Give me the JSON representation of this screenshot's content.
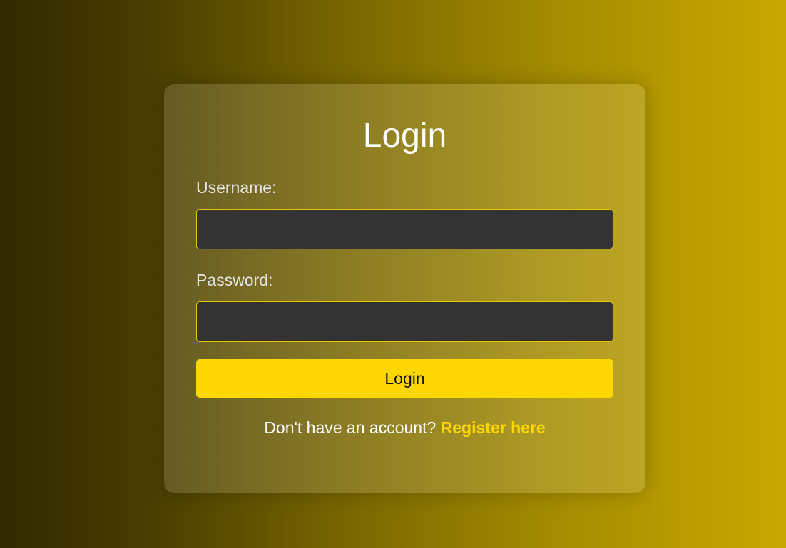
{
  "colors": {
    "accent": "#ffd700",
    "input_background": "#333333",
    "input_border": "#e7c500",
    "text": "#ffffff",
    "label_text": "#e6e6e6"
  },
  "login_card": {
    "title": "Login",
    "username": {
      "label": "Username:",
      "value": "",
      "placeholder": ""
    },
    "password": {
      "label": "Password:",
      "value": "",
      "placeholder": ""
    },
    "submit_label": "Login",
    "register_prompt": "Don't have an account?",
    "register_link": "Register here"
  }
}
